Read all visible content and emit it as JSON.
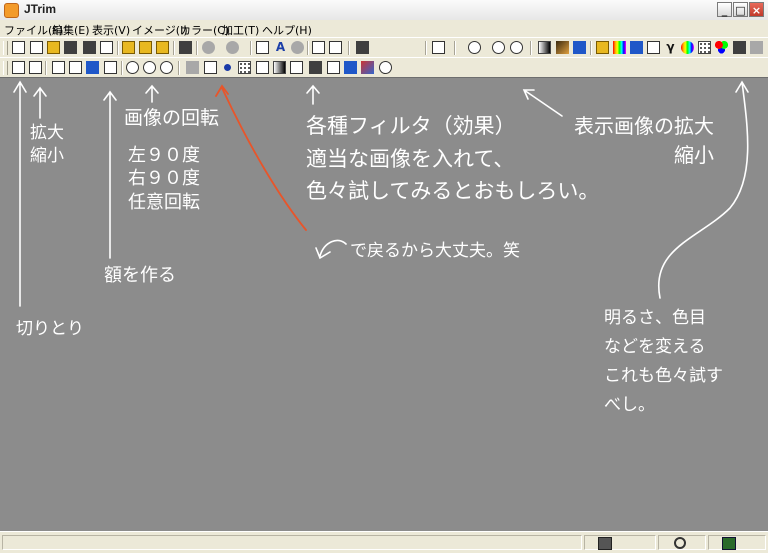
{
  "window": {
    "title": "JTrim",
    "controls": {
      "minimize": "_",
      "maximize": "□",
      "close": "×"
    }
  },
  "menu": [
    {
      "label": "ファイル(F)"
    },
    {
      "label": "編集(E)"
    },
    {
      "label": "表示(V)"
    },
    {
      "label": "イメージ(I)"
    },
    {
      "label": "カラー(C)"
    },
    {
      "label": "加工(T)"
    },
    {
      "label": "ヘルプ(H)"
    }
  ],
  "toolbar": {
    "text_tool_glyph": "A",
    "gamma_glyph": "γ"
  },
  "notes": {
    "zoom": "拡大\n縮小",
    "rotate_title": "画像の回転",
    "rotate_options": "左９０度\n右９０度\n任意回転",
    "frame": "額を作る",
    "crop": "切りとり",
    "filters": "各種フィルタ（効果）\n適当な画像を入れて、\n色々試してみるとおもしろい。",
    "undo": "で戻るから大丈夫。笑",
    "view_zoom": "表示画像の拡大\n縮小",
    "brightness": "明るさ、色目\nなどを変える\nこれも色々試す\nべし。"
  },
  "colors": {
    "canvas": "#8c8c8c",
    "annotation": "#ffffff",
    "undo_arrow": "#e8552a",
    "chrome": "#ece9d8"
  }
}
